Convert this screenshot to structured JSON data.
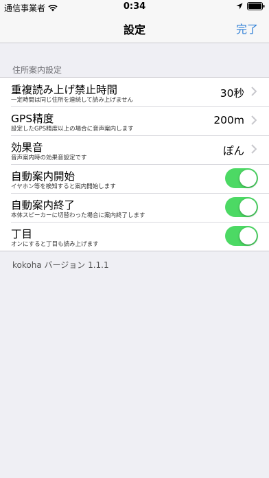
{
  "status_bar": {
    "carrier": "通信事業者",
    "time": "0:34",
    "icons": [
      "wifi-icon",
      "location-arrow-icon",
      "battery-icon"
    ]
  },
  "nav": {
    "title": "設定",
    "done_label": "完了"
  },
  "section": {
    "header": "住所案内設定"
  },
  "rows": [
    {
      "title": "重複読み上げ禁止時間",
      "subtitle": "一定時間は同じ住所を連続して読み上げません",
      "value": "30秒",
      "type": "disclosure"
    },
    {
      "title": "GPS精度",
      "subtitle": "設定したGPS精度以上の場合に音声案内します",
      "value": "200m",
      "type": "disclosure"
    },
    {
      "title": "効果音",
      "subtitle": "音声案内時の効果音設定です",
      "value": "ぽん",
      "type": "disclosure"
    },
    {
      "title": "自動案内開始",
      "subtitle": "イヤホン等を検知すると案内開始します",
      "value": "on",
      "type": "toggle"
    },
    {
      "title": "自動案内終了",
      "subtitle": "本体スピーカーに切替わった場合に案内終了します",
      "value": "on",
      "type": "toggle"
    },
    {
      "title": "丁目",
      "subtitle": "オンにすると丁目も読み上げます",
      "value": "on",
      "type": "toggle"
    }
  ],
  "footer": "kokoha バージョン 1.1.1",
  "colors": {
    "accent": "#2f7fd6",
    "toggle_on": "#4cd964",
    "background": "#efeff4"
  }
}
